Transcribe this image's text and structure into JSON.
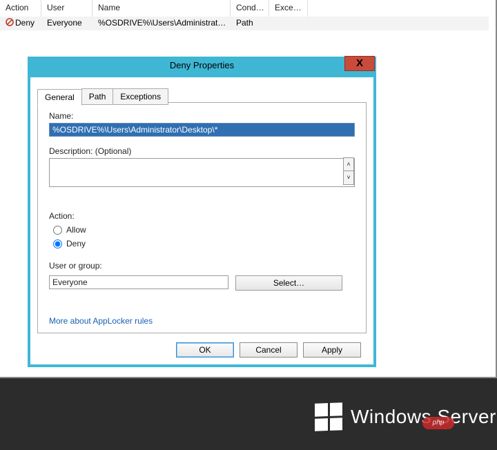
{
  "columns": {
    "action": "Action",
    "user": "User",
    "name": "Name",
    "conditions": "Conditi…",
    "exceptions": "Excepti…"
  },
  "row": {
    "action": "Deny",
    "user": "Everyone",
    "name": "%OSDRIVE%\\Users\\Administrato…",
    "conditions": "Path",
    "exceptions": ""
  },
  "dialog": {
    "title": "Deny Properties",
    "close": "X",
    "tabs": {
      "general": "General",
      "path": "Path",
      "exceptions": "Exceptions"
    },
    "name_label": "Name:",
    "name_value": "%OSDRIVE%\\Users\\Administrator\\Desktop\\*",
    "desc_label": "Description: (Optional)",
    "desc_value": "",
    "action_label": "Action:",
    "allow_label": "Allow",
    "deny_label": "Deny",
    "action_selected": "deny",
    "usr_label": "User or group:",
    "usr_value": "Everyone",
    "select_label": "Select…",
    "help_label": "More about AppLocker rules",
    "ok": "OK",
    "cancel": "Cancel",
    "apply": "Apply"
  },
  "brand": {
    "text": "Windows Server",
    "php": "php"
  }
}
